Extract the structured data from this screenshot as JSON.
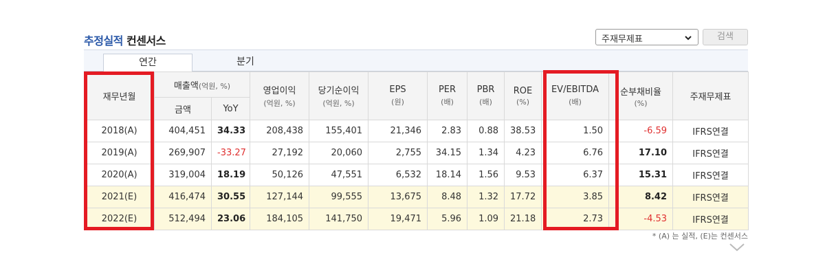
{
  "header": {
    "title_accent": "추정실적",
    "title_rest": "컨센서스",
    "select_value": "주재무제표",
    "search_label": "검색"
  },
  "tabs": [
    {
      "label": "연간"
    },
    {
      "label": "분기"
    }
  ],
  "table": {
    "columns": {
      "period": "재무년월",
      "sales": "매출액",
      "sales_unit": "(억원, %)",
      "amount": "금액",
      "yoy": "YoY",
      "op": "영업이익",
      "op_unit": "(억원, %)",
      "net": "당기순이익",
      "net_unit": "(억원, %)",
      "eps": "EPS",
      "eps_unit": "(원)",
      "per": "PER",
      "per_unit": "(배)",
      "pbr": "PBR",
      "pbr_unit": "(배)",
      "roe": "ROE",
      "roe_unit": "(%)",
      "ev": "EV/EBITDA",
      "ev_unit": "(배)",
      "debt": "순부채비율",
      "debt_unit": "(%)",
      "acct": "주재무제표"
    },
    "rows": [
      {
        "period": "2018(A)",
        "amount": "404,451",
        "yoy": "34.33",
        "op": "208,438",
        "net": "155,401",
        "eps": "21,346",
        "per": "2.83",
        "pbr": "0.88",
        "roe": "38.53",
        "ev": "1.50",
        "debt": "-6.59",
        "acct": "IFRS연결"
      },
      {
        "period": "2019(A)",
        "amount": "269,907",
        "yoy": "-33.27",
        "op": "27,192",
        "net": "20,060",
        "eps": "2,755",
        "per": "34.15",
        "pbr": "1.34",
        "roe": "4.23",
        "ev": "6.76",
        "debt": "17.10",
        "acct": "IFRS연결"
      },
      {
        "period": "2020(A)",
        "amount": "319,004",
        "yoy": "18.19",
        "op": "50,126",
        "net": "47,551",
        "eps": "6,532",
        "per": "18.14",
        "pbr": "1.56",
        "roe": "9.53",
        "ev": "6.37",
        "debt": "15.31",
        "acct": "IFRS연결"
      },
      {
        "period": "2021(E)",
        "amount": "416,474",
        "yoy": "30.55",
        "op": "127,144",
        "net": "99,555",
        "eps": "13,675",
        "per": "8.48",
        "pbr": "1.32",
        "roe": "17.72",
        "ev": "3.85",
        "debt": "8.42",
        "acct": "IFRS연결"
      },
      {
        "period": "2022(E)",
        "amount": "512,494",
        "yoy": "23.06",
        "op": "184,105",
        "net": "141,750",
        "eps": "19,471",
        "per": "5.96",
        "pbr": "1.09",
        "roe": "21.18",
        "ev": "2.73",
        "debt": "-4.53",
        "acct": "IFRS연결"
      }
    ]
  },
  "footnote": "* (A) 는 실적, (E)는 컨센서스",
  "colors": {
    "accent": "#2a58a8",
    "highlight_box": "#e41b23",
    "estimate_row": "#fdf9dd",
    "negative": "#e03030"
  }
}
